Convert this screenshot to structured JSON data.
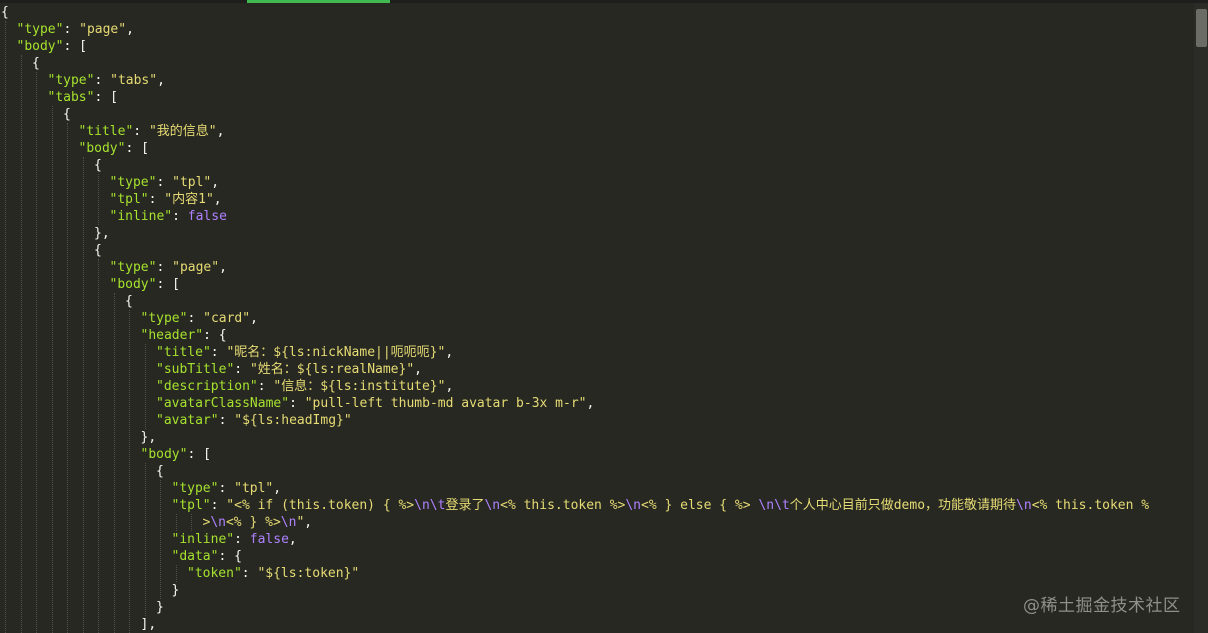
{
  "editor": {
    "language": "json",
    "theme_colors": {
      "background": "#272822",
      "key": "#a6e22e",
      "string": "#e6db74",
      "boolean": "#ae81ff",
      "escape": "#ae81ff",
      "punctuation": "#f8f8f2"
    },
    "lines": [
      {
        "indent": 0,
        "tokens": [
          {
            "t": "p",
            "v": "{"
          }
        ]
      },
      {
        "indent": 1,
        "tokens": [
          {
            "t": "k",
            "v": "\"type\""
          },
          {
            "t": "p",
            "v": ": "
          },
          {
            "t": "s",
            "v": "\"page\""
          },
          {
            "t": "p",
            "v": ","
          }
        ]
      },
      {
        "indent": 1,
        "tokens": [
          {
            "t": "k",
            "v": "\"body\""
          },
          {
            "t": "p",
            "v": ": ["
          }
        ]
      },
      {
        "indent": 2,
        "tokens": [
          {
            "t": "p",
            "v": "{"
          }
        ]
      },
      {
        "indent": 3,
        "tokens": [
          {
            "t": "k",
            "v": "\"type\""
          },
          {
            "t": "p",
            "v": ": "
          },
          {
            "t": "s",
            "v": "\"tabs\""
          },
          {
            "t": "p",
            "v": ","
          }
        ]
      },
      {
        "indent": 3,
        "tokens": [
          {
            "t": "k",
            "v": "\"tabs\""
          },
          {
            "t": "p",
            "v": ": ["
          }
        ]
      },
      {
        "indent": 4,
        "tokens": [
          {
            "t": "p",
            "v": "{"
          }
        ]
      },
      {
        "indent": 5,
        "tokens": [
          {
            "t": "k",
            "v": "\"title\""
          },
          {
            "t": "p",
            "v": ": "
          },
          {
            "t": "s",
            "v": "\"我的信息\""
          },
          {
            "t": "p",
            "v": ","
          }
        ]
      },
      {
        "indent": 5,
        "tokens": [
          {
            "t": "k",
            "v": "\"body\""
          },
          {
            "t": "p",
            "v": ": ["
          }
        ]
      },
      {
        "indent": 6,
        "tokens": [
          {
            "t": "p",
            "v": "{"
          }
        ]
      },
      {
        "indent": 7,
        "tokens": [
          {
            "t": "k",
            "v": "\"type\""
          },
          {
            "t": "p",
            "v": ": "
          },
          {
            "t": "s",
            "v": "\"tpl\""
          },
          {
            "t": "p",
            "v": ","
          }
        ]
      },
      {
        "indent": 7,
        "tokens": [
          {
            "t": "k",
            "v": "\"tpl\""
          },
          {
            "t": "p",
            "v": ": "
          },
          {
            "t": "s",
            "v": "\"内容1\""
          },
          {
            "t": "p",
            "v": ","
          }
        ]
      },
      {
        "indent": 7,
        "tokens": [
          {
            "t": "k",
            "v": "\"inline\""
          },
          {
            "t": "p",
            "v": ": "
          },
          {
            "t": "b",
            "v": "false"
          }
        ]
      },
      {
        "indent": 6,
        "tokens": [
          {
            "t": "p",
            "v": "},"
          }
        ]
      },
      {
        "indent": 6,
        "tokens": [
          {
            "t": "p",
            "v": "{"
          }
        ]
      },
      {
        "indent": 7,
        "tokens": [
          {
            "t": "k",
            "v": "\"type\""
          },
          {
            "t": "p",
            "v": ": "
          },
          {
            "t": "s",
            "v": "\"page\""
          },
          {
            "t": "p",
            "v": ","
          }
        ]
      },
      {
        "indent": 7,
        "tokens": [
          {
            "t": "k",
            "v": "\"body\""
          },
          {
            "t": "p",
            "v": ": ["
          }
        ]
      },
      {
        "indent": 8,
        "tokens": [
          {
            "t": "p",
            "v": "{"
          }
        ]
      },
      {
        "indent": 9,
        "tokens": [
          {
            "t": "k",
            "v": "\"type\""
          },
          {
            "t": "p",
            "v": ": "
          },
          {
            "t": "s",
            "v": "\"card\""
          },
          {
            "t": "p",
            "v": ","
          }
        ]
      },
      {
        "indent": 9,
        "tokens": [
          {
            "t": "k",
            "v": "\"header\""
          },
          {
            "t": "p",
            "v": ": {"
          }
        ]
      },
      {
        "indent": 10,
        "tokens": [
          {
            "t": "k",
            "v": "\"title\""
          },
          {
            "t": "p",
            "v": ": "
          },
          {
            "t": "s",
            "v": "\"昵名：${ls:nickName||呃呃呃}\""
          },
          {
            "t": "p",
            "v": ","
          }
        ]
      },
      {
        "indent": 10,
        "tokens": [
          {
            "t": "k",
            "v": "\"subTitle\""
          },
          {
            "t": "p",
            "v": ": "
          },
          {
            "t": "s",
            "v": "\"姓名：${ls:realName}\""
          },
          {
            "t": "p",
            "v": ","
          }
        ]
      },
      {
        "indent": 10,
        "tokens": [
          {
            "t": "k",
            "v": "\"description\""
          },
          {
            "t": "p",
            "v": ": "
          },
          {
            "t": "s",
            "v": "\"信息：${ls:institute}\""
          },
          {
            "t": "p",
            "v": ","
          }
        ]
      },
      {
        "indent": 10,
        "tokens": [
          {
            "t": "k",
            "v": "\"avatarClassName\""
          },
          {
            "t": "p",
            "v": ": "
          },
          {
            "t": "s",
            "v": "\"pull-left thumb-md avatar b-3x m-r\""
          },
          {
            "t": "p",
            "v": ","
          }
        ]
      },
      {
        "indent": 10,
        "tokens": [
          {
            "t": "k",
            "v": "\"avatar\""
          },
          {
            "t": "p",
            "v": ": "
          },
          {
            "t": "s",
            "v": "\"${ls:headImg}\""
          }
        ]
      },
      {
        "indent": 9,
        "tokens": [
          {
            "t": "p",
            "v": "},"
          }
        ]
      },
      {
        "indent": 9,
        "tokens": [
          {
            "t": "k",
            "v": "\"body\""
          },
          {
            "t": "p",
            "v": ": ["
          }
        ]
      },
      {
        "indent": 10,
        "tokens": [
          {
            "t": "p",
            "v": "{"
          }
        ]
      },
      {
        "indent": 11,
        "tokens": [
          {
            "t": "k",
            "v": "\"type\""
          },
          {
            "t": "p",
            "v": ": "
          },
          {
            "t": "s",
            "v": "\"tpl\""
          },
          {
            "t": "p",
            "v": ","
          }
        ]
      },
      {
        "indent": 11,
        "tokens": [
          {
            "t": "k",
            "v": "\"tpl\""
          },
          {
            "t": "p",
            "v": ": "
          },
          {
            "t": "s",
            "v": "\"<% if (this.token) { %>"
          },
          {
            "t": "e",
            "v": "\\n\\t"
          },
          {
            "t": "s",
            "v": "登录了"
          },
          {
            "t": "e",
            "v": "\\n"
          },
          {
            "t": "s",
            "v": "<% this.token %>"
          },
          {
            "t": "e",
            "v": "\\n"
          },
          {
            "t": "s",
            "v": "<% } else { %> "
          },
          {
            "t": "e",
            "v": "\\n\\t"
          },
          {
            "t": "s",
            "v": "个人中心目前只做demo，功能敬请期待"
          },
          {
            "t": "e",
            "v": "\\n"
          },
          {
            "t": "s",
            "v": "<% this.token %"
          }
        ]
      },
      {
        "indent": 13,
        "wrap": true,
        "tokens": [
          {
            "t": "s",
            "v": ">"
          },
          {
            "t": "e",
            "v": "\\n"
          },
          {
            "t": "s",
            "v": "<% } %>"
          },
          {
            "t": "e",
            "v": "\\n"
          },
          {
            "t": "s",
            "v": "\""
          },
          {
            "t": "p",
            "v": ","
          }
        ]
      },
      {
        "indent": 11,
        "tokens": [
          {
            "t": "k",
            "v": "\"inline\""
          },
          {
            "t": "p",
            "v": ": "
          },
          {
            "t": "b",
            "v": "false"
          },
          {
            "t": "p",
            "v": ","
          }
        ]
      },
      {
        "indent": 11,
        "tokens": [
          {
            "t": "k",
            "v": "\"data\""
          },
          {
            "t": "p",
            "v": ": {"
          }
        ]
      },
      {
        "indent": 12,
        "tokens": [
          {
            "t": "k",
            "v": "\"token\""
          },
          {
            "t": "p",
            "v": ": "
          },
          {
            "t": "s",
            "v": "\"${ls:token}\""
          }
        ]
      },
      {
        "indent": 11,
        "tokens": [
          {
            "t": "p",
            "v": "}"
          }
        ]
      },
      {
        "indent": 10,
        "tokens": [
          {
            "t": "p",
            "v": "}"
          }
        ]
      },
      {
        "indent": 9,
        "tokens": [
          {
            "t": "p",
            "v": "],"
          }
        ]
      }
    ]
  },
  "watermark": "@稀土掘金技术社区"
}
